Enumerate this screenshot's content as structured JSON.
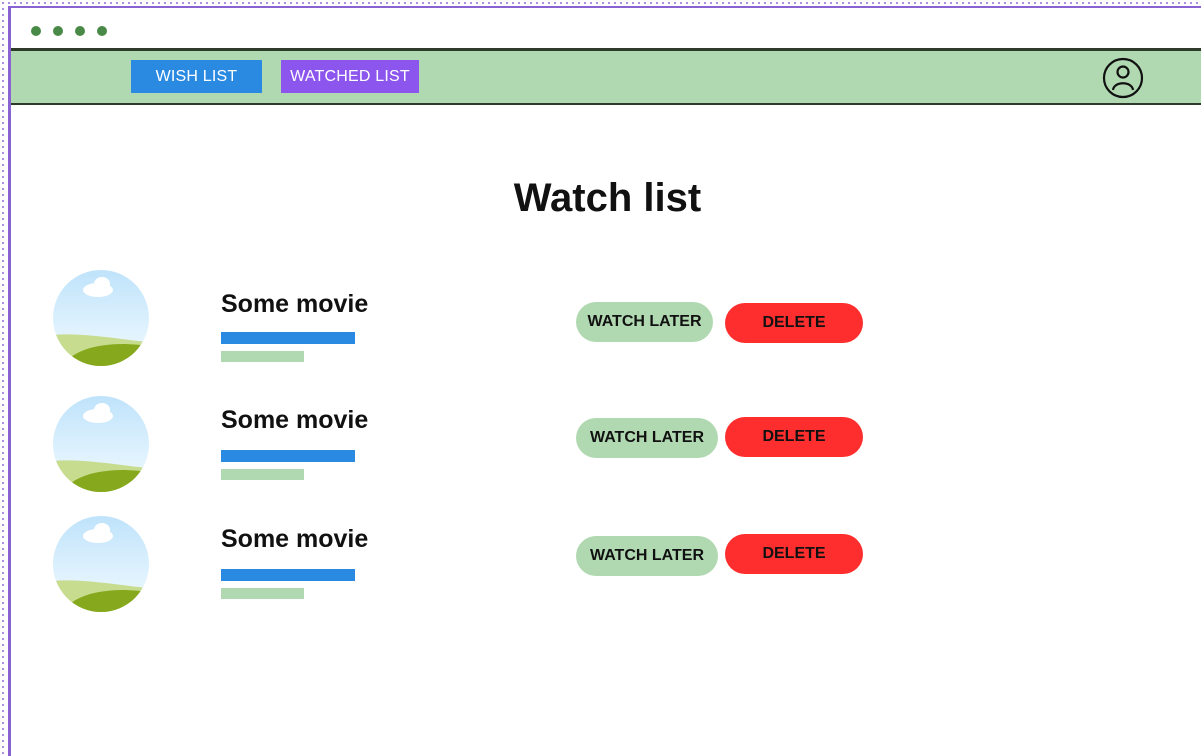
{
  "nav": {
    "wish_list_label": "WISH LIST",
    "watched_list_label": "WATCHED LIST",
    "profile_icon": "user-circle-icon"
  },
  "page": {
    "title": "Watch list"
  },
  "movies": [
    {
      "title": "Some movie",
      "thumbnail_icon": "landscape-image-icon",
      "watch_later_label": "WATCH LATER",
      "delete_label": "DELETE"
    },
    {
      "title": "Some movie",
      "thumbnail_icon": "landscape-image-icon",
      "watch_later_label": "WATCH LATER",
      "delete_label": "DELETE"
    },
    {
      "title": "Some movie",
      "thumbnail_icon": "landscape-image-icon",
      "watch_later_label": "WATCH LATER",
      "delete_label": "DELETE"
    }
  ],
  "colors": {
    "nav_background": "#b1d9b1",
    "wish_list_button": "#2a8ae2",
    "watched_list_button": "#8c55ee",
    "watch_later_button": "#b1d9b1",
    "delete_button": "#ff2e2e",
    "frame_border": "#8a63d2"
  }
}
